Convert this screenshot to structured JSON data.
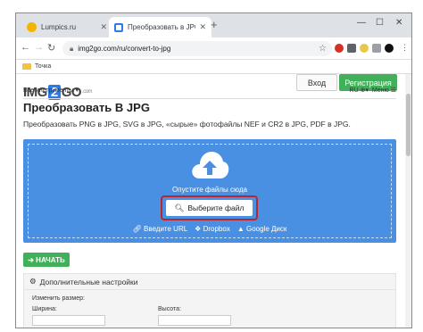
{
  "browser": {
    "tabs": [
      {
        "label": "Lumpics.ru",
        "active": false
      },
      {
        "label": "Преобразовать в JPG — Конв",
        "active": true
      }
    ],
    "new_tab": "+",
    "url": "img2go.com/ru/convert-to-jpg",
    "bookmark": "Точка"
  },
  "site": {
    "logo": {
      "left": "IMG",
      "mid": "2",
      "right": "GO",
      "suffix": ".com"
    },
    "login_label": "Вход",
    "register_label": "Регистрация",
    "all_tools": "Все инструменты ▾",
    "lang": "RU ⊕▾",
    "menu": "Меню ☰"
  },
  "main": {
    "title": "Преобразовать В JPG",
    "subtitle": "Преобразовать PNG в JPG, SVG в JPG, «сырые» фотофайлы NEF и CR2 в JPG, PDF в JPG.",
    "drop_text": "Опустите файлы сюда",
    "choose_label": "Выберите файл",
    "sources": [
      "Введите URL",
      "Dropbox",
      "Google Диск"
    ],
    "start_label": "НАЧАТЬ",
    "settings_title": "Дополнительные настройки",
    "resize_label": "Изменить размер:",
    "width_label": "Ширина:",
    "height_label": "Высота:"
  },
  "colors": {
    "accent": "#4a90e2",
    "green": "#42b05a",
    "highlight": "#c0242b"
  }
}
